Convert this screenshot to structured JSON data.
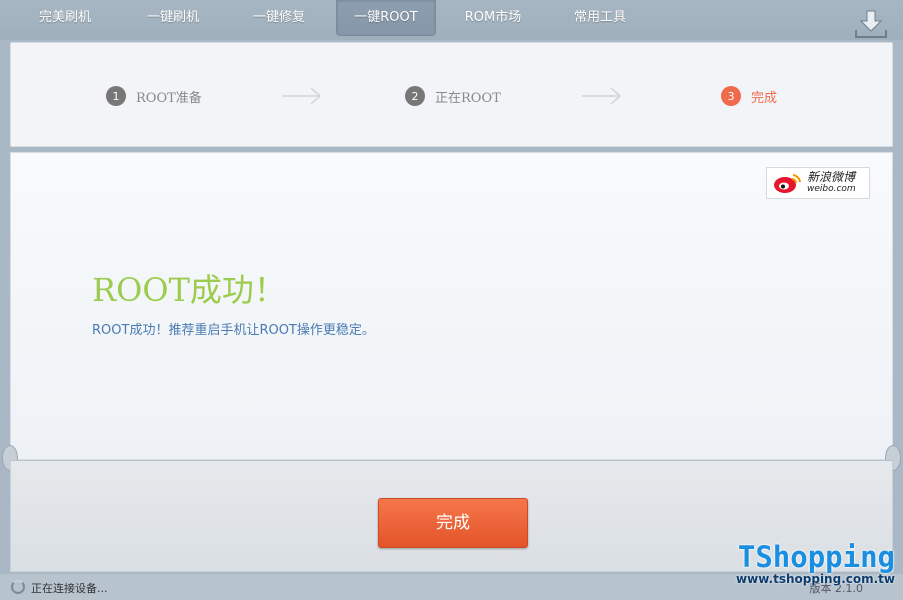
{
  "nav": {
    "items": [
      {
        "label": "完美刷机"
      },
      {
        "label": "一键刷机"
      },
      {
        "label": "一键修复"
      },
      {
        "label": "一键ROOT",
        "active": true
      },
      {
        "label": "ROM市场"
      },
      {
        "label": "常用工具"
      }
    ],
    "download_icon": "download-icon"
  },
  "steps": [
    {
      "number": "1",
      "label": "ROOT准备"
    },
    {
      "number": "2",
      "label": "正在ROOT"
    },
    {
      "number": "3",
      "label": "完成",
      "current": true
    }
  ],
  "weibo": {
    "icon": "weibo-icon",
    "title": "新浪微博",
    "subtitle": "weibo.com"
  },
  "result": {
    "title": "ROOT成功！",
    "description": "ROOT成功！推荐重启手机让ROOT操作更稳定。"
  },
  "done_button": "完成",
  "status": {
    "text": "正在连接设备...",
    "version": "版本 2.1.0"
  },
  "watermark": {
    "title": "TShopping",
    "url": "www.tshopping.com.tw"
  },
  "colors": {
    "accent": "#f06a4c",
    "success": "#9ccb4d",
    "link": "#4a7bb2",
    "button": "#e4542a"
  }
}
